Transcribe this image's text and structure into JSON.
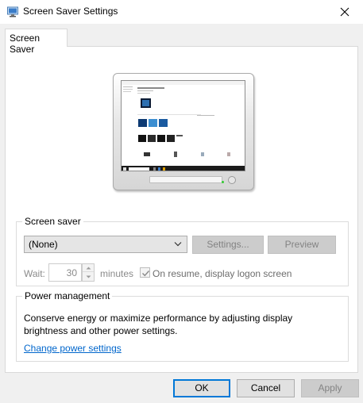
{
  "window": {
    "title": "Screen Saver Settings",
    "icon": "monitor-settings-icon",
    "close_icon": "close-icon"
  },
  "tab": {
    "label": "Screen Saver"
  },
  "preview": {
    "icon": "monitor-preview"
  },
  "screen_saver": {
    "group_label": "Screen saver",
    "selected": "(None)",
    "settings_label": "Settings...",
    "preview_label": "Preview",
    "wait_label": "Wait:",
    "wait_value": "30",
    "minutes_label": "minutes",
    "on_resume_label": "On resume, display logon screen",
    "on_resume_checked": true
  },
  "power": {
    "group_label": "Power management",
    "description": "Conserve energy or maximize performance by adjusting display brightness and other power settings.",
    "link_label": "Change power settings"
  },
  "footer": {
    "ok_label": "OK",
    "cancel_label": "Cancel",
    "apply_label": "Apply"
  },
  "colors": {
    "accent": "#0078d7",
    "link": "#0066cc",
    "disabled_text": "#838383"
  }
}
